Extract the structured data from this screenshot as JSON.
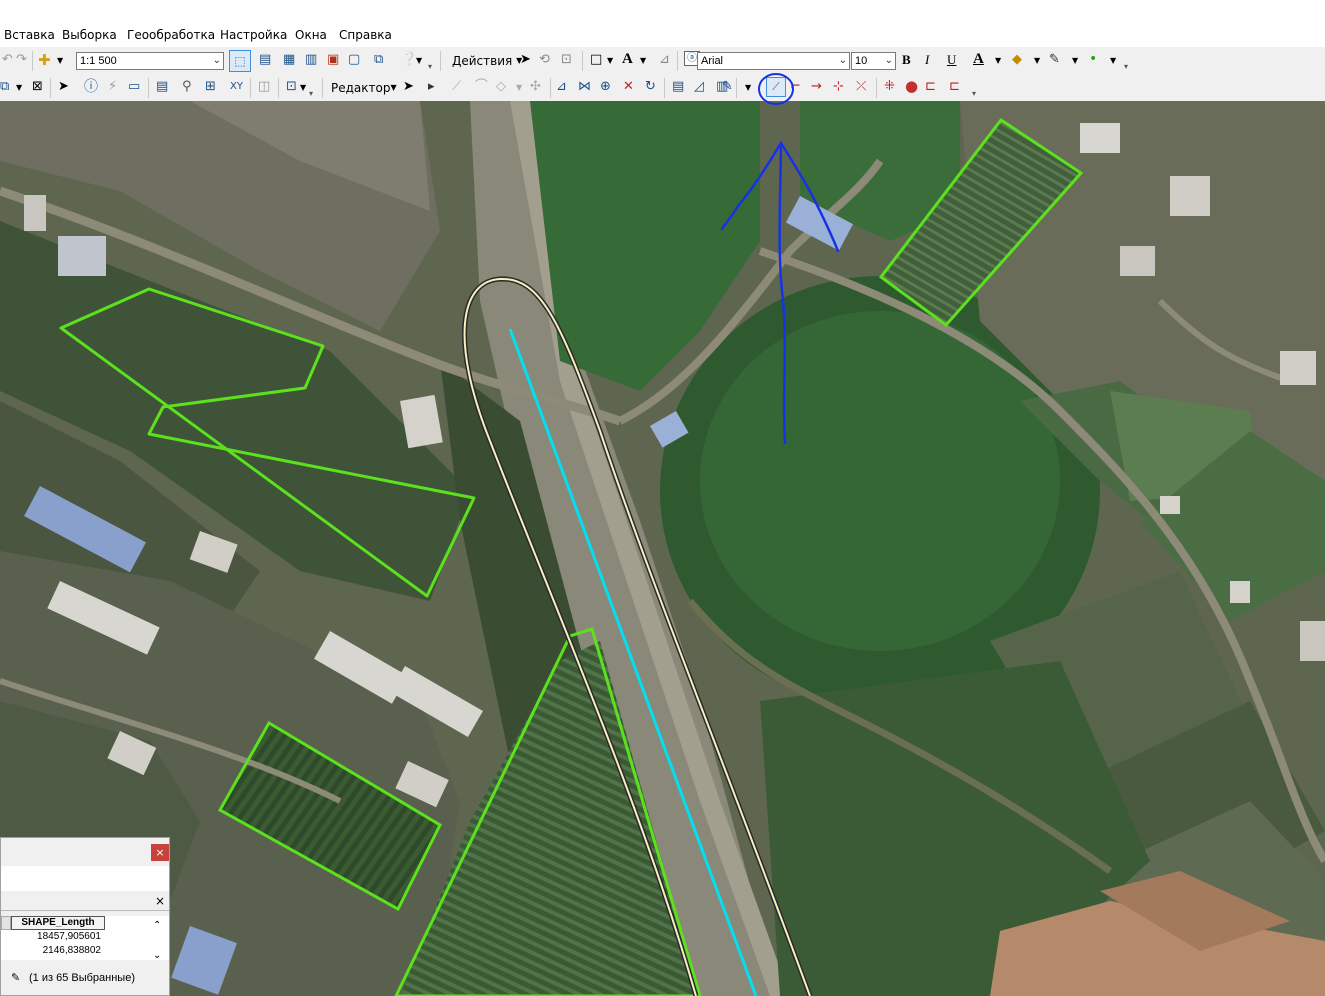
{
  "menu": [
    "Вставка",
    "Выборка",
    "Геообработка",
    "Настройка",
    "Окна",
    "Справка"
  ],
  "toolbar1": {
    "scale_value": "1:1 500",
    "actions_label": "Действия",
    "font_name": "Arial",
    "font_size": "10",
    "bold_label": "B",
    "italic_label": "I",
    "underline_label": "U",
    "text_label": "A"
  },
  "toolbar2": {
    "editor_label": "Редактор"
  },
  "attribute_table": {
    "close_label": "×",
    "table_close_label": "×",
    "column_header": "SHAPE_Length",
    "rows": [
      "18457,905601",
      "2146,838802"
    ],
    "status": "(1 из 65 Выбранные)"
  },
  "colors": {
    "polygon_outline": "#5ce11e",
    "cyan_line": "#00e0f0",
    "annotation_blue": "#1632e6",
    "toolbar_bg": "#f0f0f0"
  }
}
